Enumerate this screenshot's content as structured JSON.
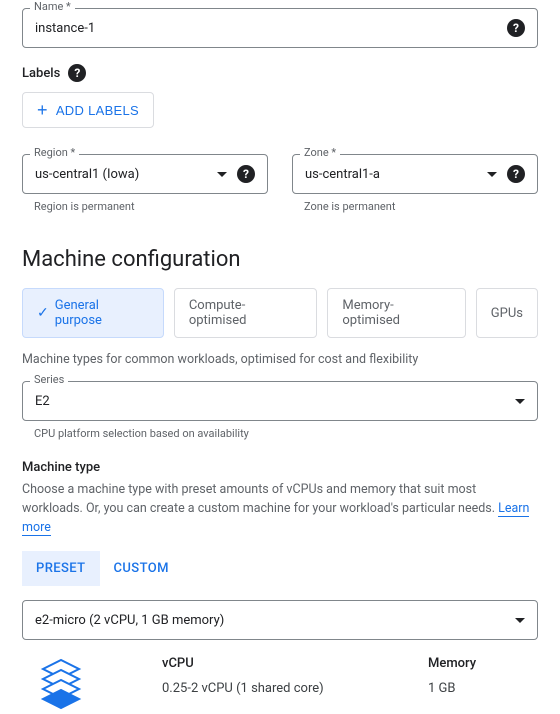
{
  "name": {
    "label": "Name *",
    "value": "instance-1"
  },
  "labels": {
    "heading": "Labels",
    "add_button": "ADD LABELS"
  },
  "region": {
    "label": "Region *",
    "value": "us-central1 (Iowa)",
    "helper": "Region is permanent"
  },
  "zone": {
    "label": "Zone *",
    "value": "us-central1-a",
    "helper": "Zone is permanent"
  },
  "machine_config": {
    "heading": "Machine configuration",
    "tabs": {
      "general": "General purpose",
      "compute": "Compute-optimised",
      "memory": "Memory-optimised",
      "gpus": "GPUs"
    },
    "desc": "Machine types for common workloads, optimised for cost and flexibility",
    "series": {
      "label": "Series",
      "value": "E2",
      "helper": "CPU platform selection based on availability"
    },
    "machine_type": {
      "heading": "Machine type",
      "desc": "Choose a machine type with preset amounts of vCPUs and memory that suit most workloads. Or, you can create a custom machine for your workload's particular needs. ",
      "learn_more": "Learn more",
      "preset_tab": "PRESET",
      "custom_tab": "CUSTOM",
      "selected": "e2-micro (2 vCPU, 1 GB memory)",
      "vcpu_label": "vCPU",
      "vcpu_value": "0.25-2 vCPU (1 shared core)",
      "memory_label": "Memory",
      "memory_value": "1 GB"
    }
  }
}
